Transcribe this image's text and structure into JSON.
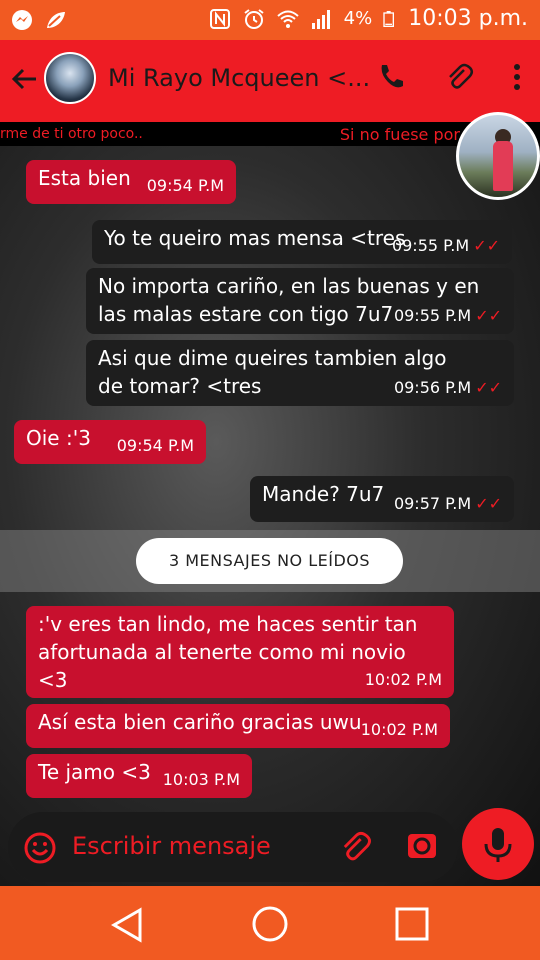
{
  "status": {
    "battery": "4%",
    "time": "10:03 p.m."
  },
  "header": {
    "contact_name": "Mi Rayo Mcqueen <..."
  },
  "ticker": {
    "left": "rme de ti otro poco..",
    "right": "Si no fuese por"
  },
  "messages": [
    {
      "text": "Esta bien",
      "time": "09:54 P.M"
    },
    {
      "text": "Yo te queiro mas mensa <tres",
      "time": "09:55 P.M"
    },
    {
      "text": "No importa cariño, en las buenas y en las malas estare con tigo 7u7",
      "time": "09:55 P.M"
    },
    {
      "text": "Asi que dime queires tambien algo de tomar? <tres",
      "time": "09:56 P.M"
    },
    {
      "text": "Oie :'3",
      "time": "09:54 P.M"
    },
    {
      "text": "Mande? 7u7",
      "time": "09:57 P.M"
    },
    {
      "text": ":'v eres tan lindo, me haces sentir tan afortunada al tenerte como mi novio <3",
      "time": "10:02 P.M"
    },
    {
      "text": "Así esta bien cariño gracias uwu",
      "time": "10:02 P.M"
    },
    {
      "text": "Te jamo <3",
      "time": "10:03 P.M"
    }
  ],
  "unread_label": "3 MENSAJES NO LEÍDOS",
  "input": {
    "placeholder": "Escribir mensaje"
  },
  "icons": {
    "messenger": "messenger-icon",
    "status_app": "leaf-icon",
    "nfc": "nfc-icon",
    "alarm": "alarm-icon",
    "wifi": "wifi-icon",
    "signal": "signal-icon",
    "battery": "battery-icon",
    "back": "back-arrow-icon",
    "call": "phone-icon",
    "attach": "paperclip-icon",
    "menu": "more-vert-icon",
    "emoji": "emoji-icon",
    "camera": "camera-icon",
    "mic": "mic-icon"
  },
  "colors": {
    "accent": "#ee1c24",
    "status_bar": "#f15a22",
    "incoming_bubble": "#c8102e",
    "outgoing_bubble": "#1e1e1e"
  }
}
